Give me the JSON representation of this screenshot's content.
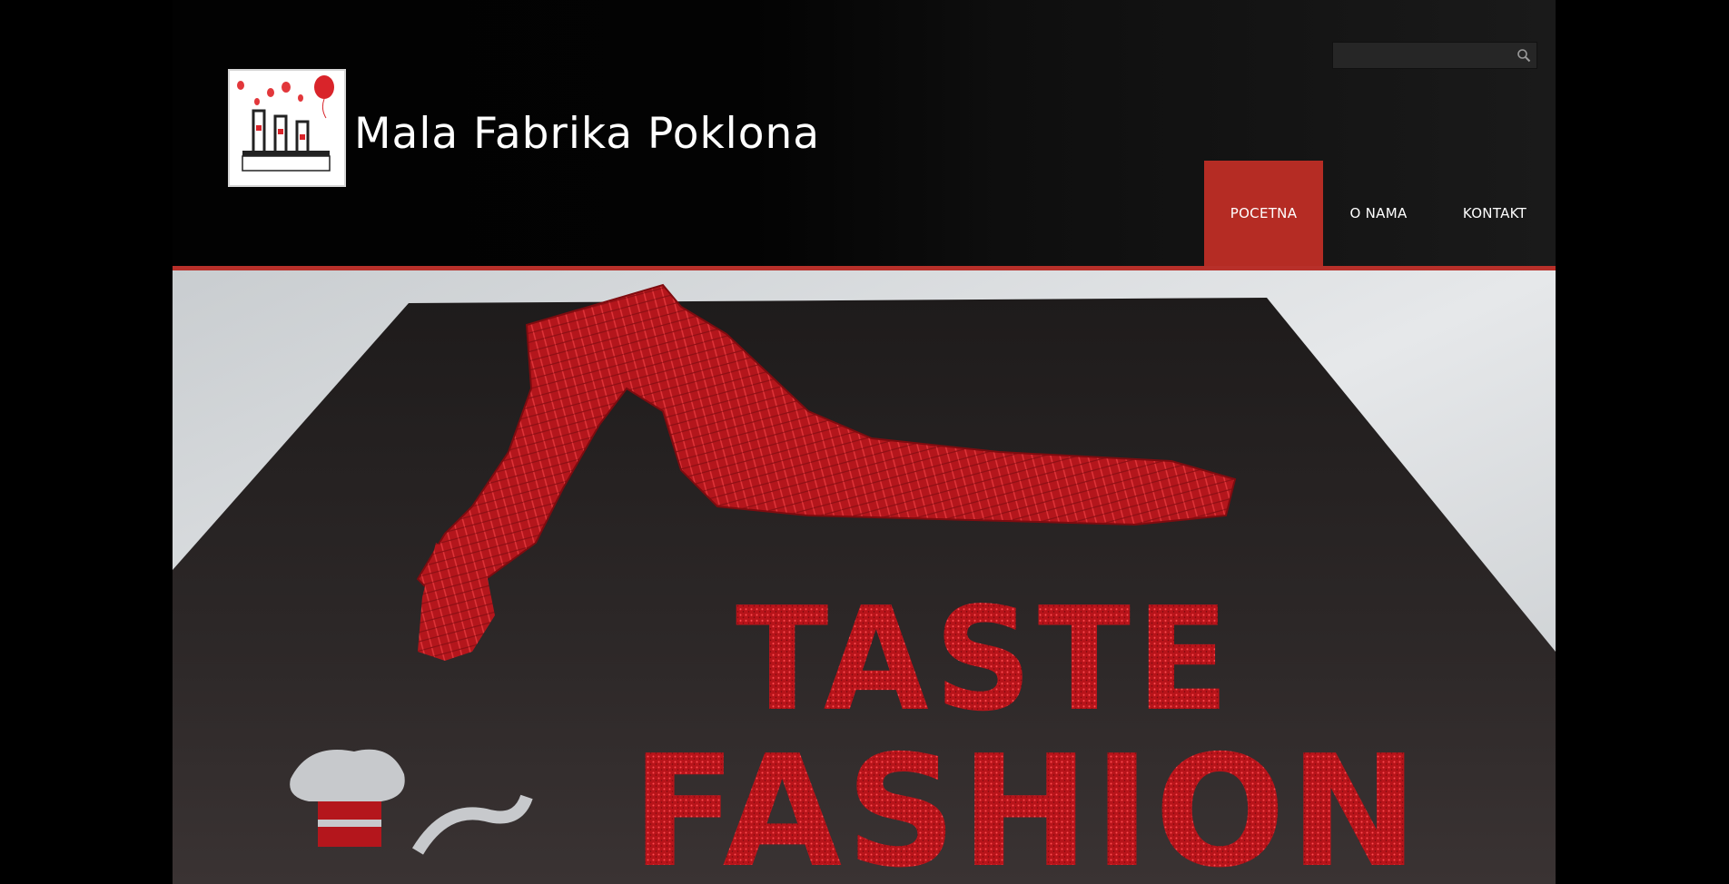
{
  "site": {
    "title": "Mala Fabrika Poklona",
    "logo_text": "Mala fabrika poklona"
  },
  "search": {
    "placeholder": "",
    "value": ""
  },
  "nav": {
    "items": [
      {
        "label": "POCETNA",
        "active": true
      },
      {
        "label": "O NAMA",
        "active": false
      },
      {
        "label": "KONTAKT",
        "active": false
      }
    ]
  },
  "hero": {
    "line1": "TASTE",
    "line2": "FASHION"
  },
  "colors": {
    "accent": "#b52c24",
    "background": "#000000",
    "text": "#ffffff"
  },
  "icons": {
    "search": "search-icon"
  }
}
